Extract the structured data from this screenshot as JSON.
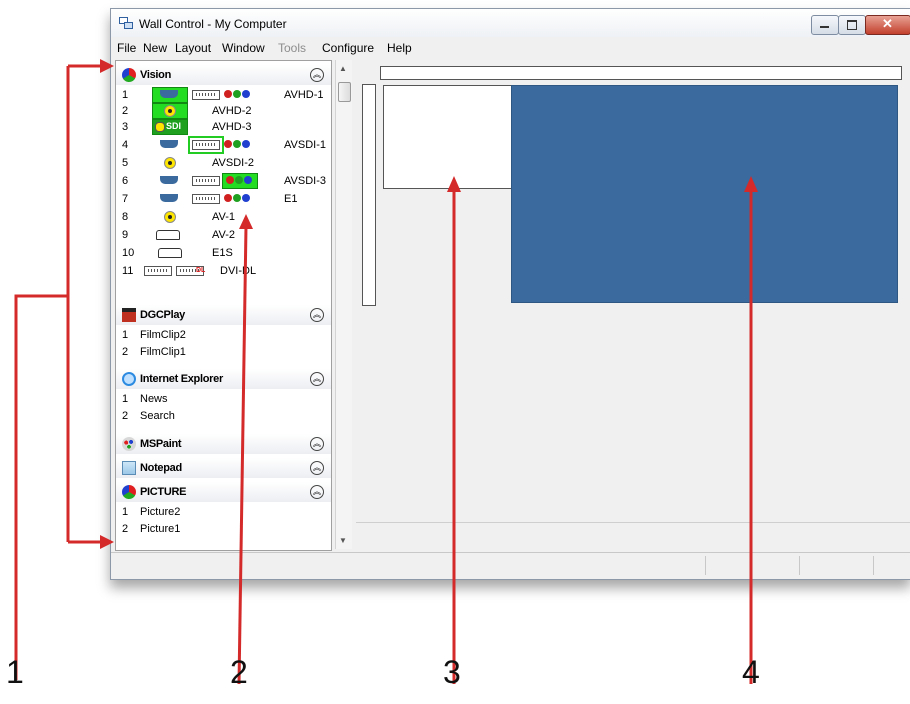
{
  "window": {
    "title": "Wall Control - My Computer",
    "controls": {
      "minimize_icon": "minimize-icon",
      "maximize_icon": "maximize-icon",
      "close_icon": "close-icon"
    }
  },
  "menu": [
    "File",
    "New",
    "Layout",
    "Window",
    "Tools",
    "Configure",
    "Help"
  ],
  "groups": {
    "vision": {
      "title": "Vision",
      "items": [
        {
          "num": "1",
          "label": "AVHD-1"
        },
        {
          "num": "2",
          "label": "AVHD-2"
        },
        {
          "num": "3",
          "label": "AVHD-3"
        },
        {
          "num": "4",
          "label": "AVSDI-1"
        },
        {
          "num": "5",
          "label": "AVSDI-2"
        },
        {
          "num": "6",
          "label": "AVSDI-3"
        },
        {
          "num": "7",
          "label": "E1"
        },
        {
          "num": "8",
          "label": "AV-1"
        },
        {
          "num": "9",
          "label": "AV-2"
        },
        {
          "num": "10",
          "label": "E1S"
        },
        {
          "num": "11",
          "label": "DVI-DL"
        }
      ],
      "sdi_tag": "SDI",
      "dl_tag": "DL"
    },
    "dgcplay": {
      "title": "DGCPlay",
      "items": [
        {
          "num": "1",
          "label": "FilmClip2"
        },
        {
          "num": "2",
          "label": "FilmClip1"
        }
      ]
    },
    "ie": {
      "title": "Internet Explorer",
      "items": [
        {
          "num": "1",
          "label": "News"
        },
        {
          "num": "2",
          "label": "Search"
        }
      ]
    },
    "mspaint": {
      "title": "MSPaint"
    },
    "notepad": {
      "title": "Notepad"
    },
    "picture": {
      "title": "PICTURE",
      "items": [
        {
          "num": "1",
          "label": "Picture2"
        },
        {
          "num": "2",
          "label": "Picture1"
        }
      ]
    }
  },
  "callouts": [
    "1",
    "2",
    "3",
    "4"
  ],
  "colors": {
    "accent_red": "#d42a2a",
    "screen_blue": "#3a6a9e",
    "source_green": "#22dd22"
  }
}
